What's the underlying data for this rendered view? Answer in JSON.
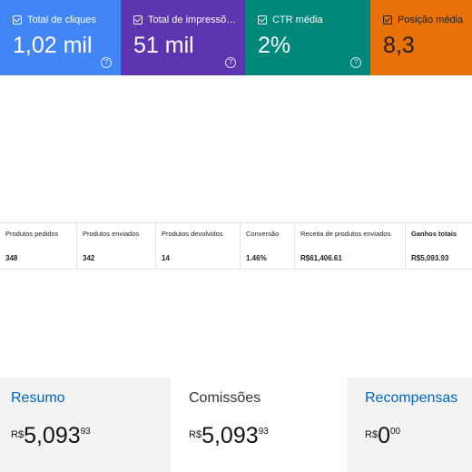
{
  "metrics": [
    {
      "label": "Total de cliques",
      "value": "1,02 mil",
      "help": "?"
    },
    {
      "label": "Total de impressõ…",
      "value": "51 mil",
      "help": "?"
    },
    {
      "label": "CTR média",
      "value": "2%",
      "help": "?"
    },
    {
      "label": "Posição média",
      "value": "8,3"
    }
  ],
  "metric_colors": {
    "clicks": "#4285f4",
    "impressions": "#5e35b1",
    "ctr": "#00897b",
    "position": "#e8710a"
  },
  "stats": {
    "columns": [
      {
        "label": "Produtos pedidos",
        "value": "348"
      },
      {
        "label": "Produtos enviados",
        "value": "342"
      },
      {
        "label": "Produtos devolvidos",
        "value": "14"
      },
      {
        "label": "Conversão",
        "value": "1.46%"
      },
      {
        "label": "Receita de produtos enviados",
        "value": "R$61,406.61"
      },
      {
        "label": "Ganhos totais",
        "value": "R$5,093.93"
      }
    ]
  },
  "tabs": [
    {
      "label": "Resumo",
      "currency": "R$",
      "integer": "5,093",
      "decimal": "93",
      "selected": false
    },
    {
      "label": "Comissões",
      "currency": "R$",
      "integer": "5,093",
      "decimal": "93",
      "selected": true
    },
    {
      "label": "Recompensas",
      "currency": "R$",
      "integer": "0",
      "decimal": "00",
      "selected": false
    }
  ]
}
